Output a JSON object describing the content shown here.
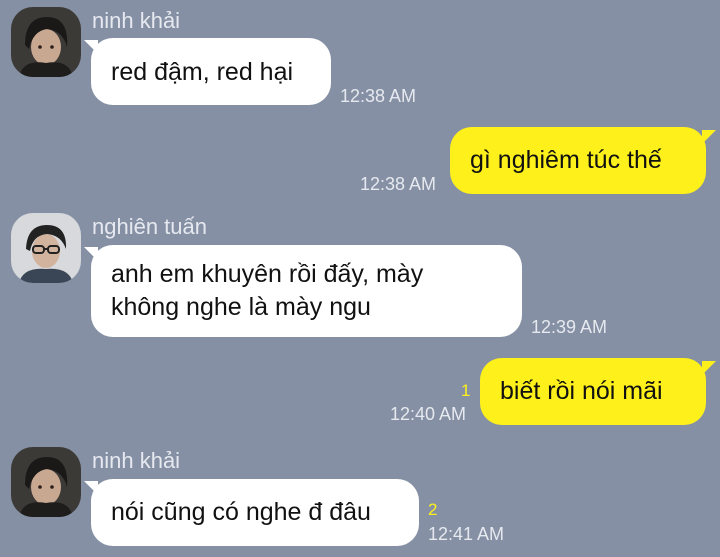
{
  "theme": {
    "background": "#8590a4",
    "incoming_bubble": "#ffffff",
    "outgoing_bubble": "#fef01b",
    "meta_text": "#e6e9ef",
    "unread_color": "#fef01b"
  },
  "messages": [
    {
      "direction": "incoming",
      "sender": "ninh khải",
      "avatar_icon": "profile-photo",
      "lines": [
        "red đậm, red hại"
      ],
      "time": "12:38 AM"
    },
    {
      "direction": "outgoing",
      "lines": [
        "gì nghiêm túc thế"
      ],
      "time": "12:38 AM"
    },
    {
      "direction": "incoming",
      "sender": "nghiên tuấn",
      "avatar_icon": "profile-photo",
      "lines": [
        "anh em khuyên rồi đấy, mày",
        "không nghe là mày ngu"
      ],
      "time": "12:39 AM"
    },
    {
      "direction": "outgoing",
      "lines": [
        "biết rồi nói mãi"
      ],
      "unread": "1",
      "time": "12:40 AM"
    },
    {
      "direction": "incoming",
      "sender": "ninh khải",
      "avatar_icon": "profile-photo",
      "lines": [
        "nói cũng có nghe đ đâu"
      ],
      "unread": "2",
      "time": "12:41 AM"
    }
  ]
}
